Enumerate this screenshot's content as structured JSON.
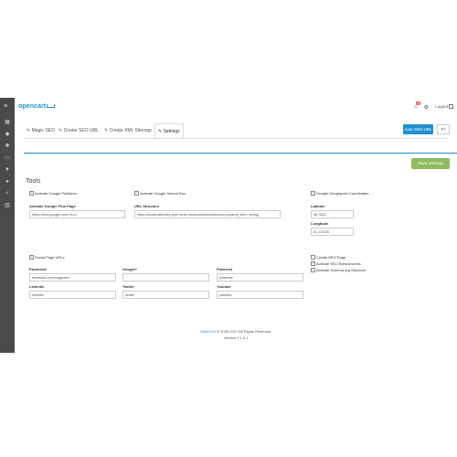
{
  "brand": {
    "logo_text": "opencart"
  },
  "header": {
    "notification_count": "1",
    "logout_label": "Logout"
  },
  "sidebar": {
    "icons": [
      "dashboard-icon",
      "tags-icon",
      "puzzle-icon",
      "desktop-icon",
      "cart-icon",
      "user-icon",
      "share-icon",
      "chart-icon"
    ]
  },
  "tabs": [
    "Magic SEO",
    "Create SEO URL",
    "Create XML Sitemap",
    "Settings"
  ],
  "actions": {
    "auto_seo": "Auto SEO URL",
    "back": "↩",
    "save": "Save Settings"
  },
  "tools": {
    "heading": "Tools",
    "activate_google_publisher": "Activate Google Publisher",
    "activate_google_search_box": "Activate Google Search Box",
    "google_geographic_coordinates": "Google Geographic Coordinates",
    "plus_page_label": "Activate Google Plus Page",
    "plus_page_value": "https://plus.google.com/?h=n",
    "url_structure_label": "URL Structure",
    "url_structure_value": "https://localhost/index.php?route=product/search&search={search_term_string}",
    "latitude_label": "Latitude",
    "latitude_value": "46.7821",
    "longitude_label": "Longitude",
    "longitude_value": "61.123.65",
    "social_page_urls": "Social Page URLs",
    "create_seo_page": "Create SEO Page",
    "activate_seo_breadcrumbs": "Activate SEO Breadcrumbs",
    "activate_schema": "Activate Schema.org Structure",
    "facebook_label": "Facebook",
    "facebook_value": "facebook.com/magicseo",
    "googleplus_label": "Google+",
    "googleplus_value": "",
    "pinterest_label": "Pinterest",
    "pinterest_value": "pinterest",
    "linkedin_label": "LinkedIn",
    "linkedin_value": "linkedin",
    "twitter_label": "Twitter",
    "twitter_value": "twitter",
    "youtube_label": "Youtube",
    "youtube_value": "youtube"
  },
  "footer": {
    "link": "OpenCart",
    "copyright": " © 2009-2017 All Rights Reserved.",
    "version": "Version 2.1.0.1"
  }
}
